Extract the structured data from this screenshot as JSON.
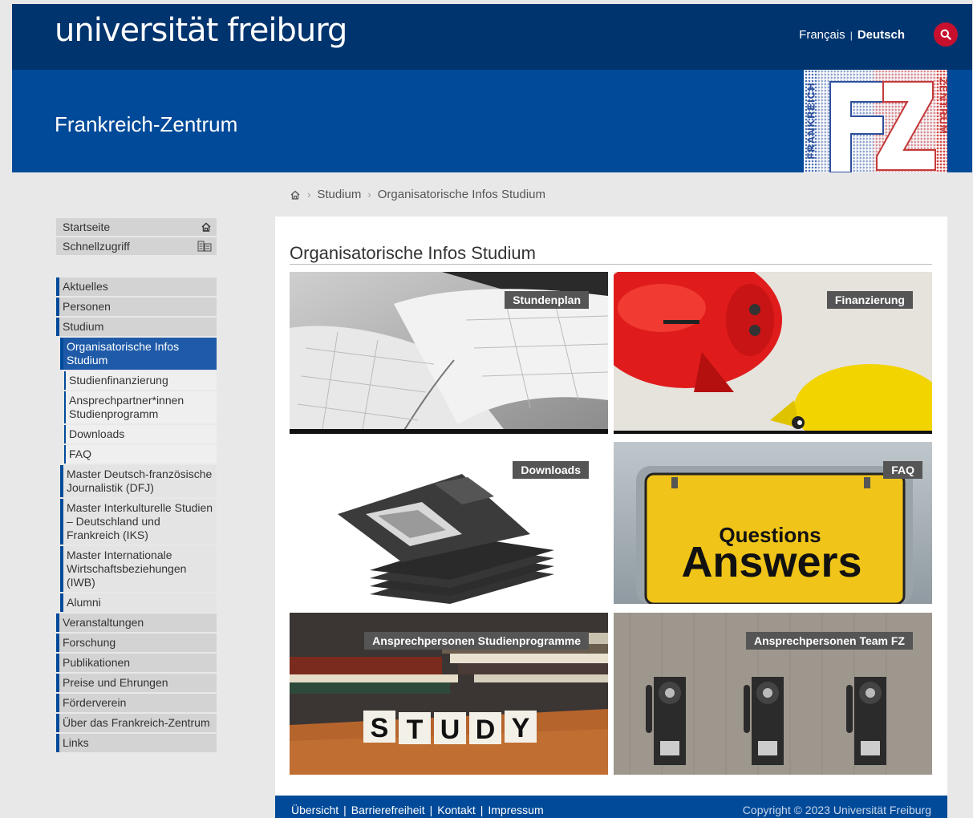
{
  "header": {
    "logo": "universität freiburg",
    "lang_fr": "Français",
    "lang_sep": "|",
    "lang_de": "Deutsch",
    "search_icon": "search-icon"
  },
  "banner": {
    "title": "Frankreich-Zentrum",
    "logo_left": "FRANKREICH",
    "logo_right": "ZENTRUM",
    "logo_letters": "FZ"
  },
  "breadcrumb": {
    "home_icon": "home-icon",
    "items": [
      "Studium",
      "Organisatorische Infos Studium"
    ]
  },
  "quick": [
    {
      "label": "Startseite",
      "icon": "home-icon"
    },
    {
      "label": "Schnellzugriff",
      "icon": "grid-icon"
    }
  ],
  "menu": [
    {
      "label": "Aktuelles",
      "level": "top"
    },
    {
      "label": "Personen",
      "level": "top"
    },
    {
      "label": "Studium",
      "level": "top"
    },
    {
      "label": "Organisatorische Infos Studium",
      "level": "active"
    },
    {
      "label": "Studienfinanzierung",
      "level": "subsub"
    },
    {
      "label": "Ansprechpartner*innen Studienprogramm",
      "level": "subsub"
    },
    {
      "label": "Downloads",
      "level": "subsub"
    },
    {
      "label": "FAQ",
      "level": "subsub"
    },
    {
      "label": "Master Deutsch-französische Journalistik (DFJ)",
      "level": "sub"
    },
    {
      "label": "Master Interkulturelle Studien – Deutschland und Frankreich (IKS)",
      "level": "sub"
    },
    {
      "label": "Master Internationale Wirtschaftsbeziehungen (IWB)",
      "level": "sub"
    },
    {
      "label": "Alumni",
      "level": "sub"
    },
    {
      "label": "Veranstaltungen",
      "level": "top"
    },
    {
      "label": "Forschung",
      "level": "top"
    },
    {
      "label": "Publikationen",
      "level": "top"
    },
    {
      "label": "Preise und Ehrungen",
      "level": "top"
    },
    {
      "label": "Förderverein",
      "level": "top"
    },
    {
      "label": "Über das Frankreich-Zentrum",
      "level": "top"
    },
    {
      "label": "Links",
      "level": "top"
    }
  ],
  "main": {
    "title": "Organisatorische Infos Studium",
    "tiles": [
      {
        "label": "Stundenplan",
        "image": "calendar-book"
      },
      {
        "label": "Finanzierung",
        "image": "piggy-banks"
      },
      {
        "label": "Downloads",
        "image": "floppy-disks"
      },
      {
        "label": "FAQ",
        "image": "questions-answers-sign",
        "sign_top": "Questions",
        "sign_bottom": "Answers"
      },
      {
        "label": "Ansprechpersonen Studienprogramme",
        "image": "study-dice",
        "dice": [
          "S",
          "T",
          "U",
          "D",
          "Y"
        ]
      },
      {
        "label": "Ansprechpersonen Team FZ",
        "image": "wall-telephones"
      }
    ]
  },
  "footer": {
    "links": [
      "Übersicht",
      "Barrierefreiheit",
      "Kontakt",
      "Impressum"
    ],
    "sep": "|",
    "copyright": "Copyright © 2023 Universität Freiburg"
  },
  "colors": {
    "dark_blue": "#00346e",
    "blue": "#004a99",
    "red": "#c8102e"
  }
}
